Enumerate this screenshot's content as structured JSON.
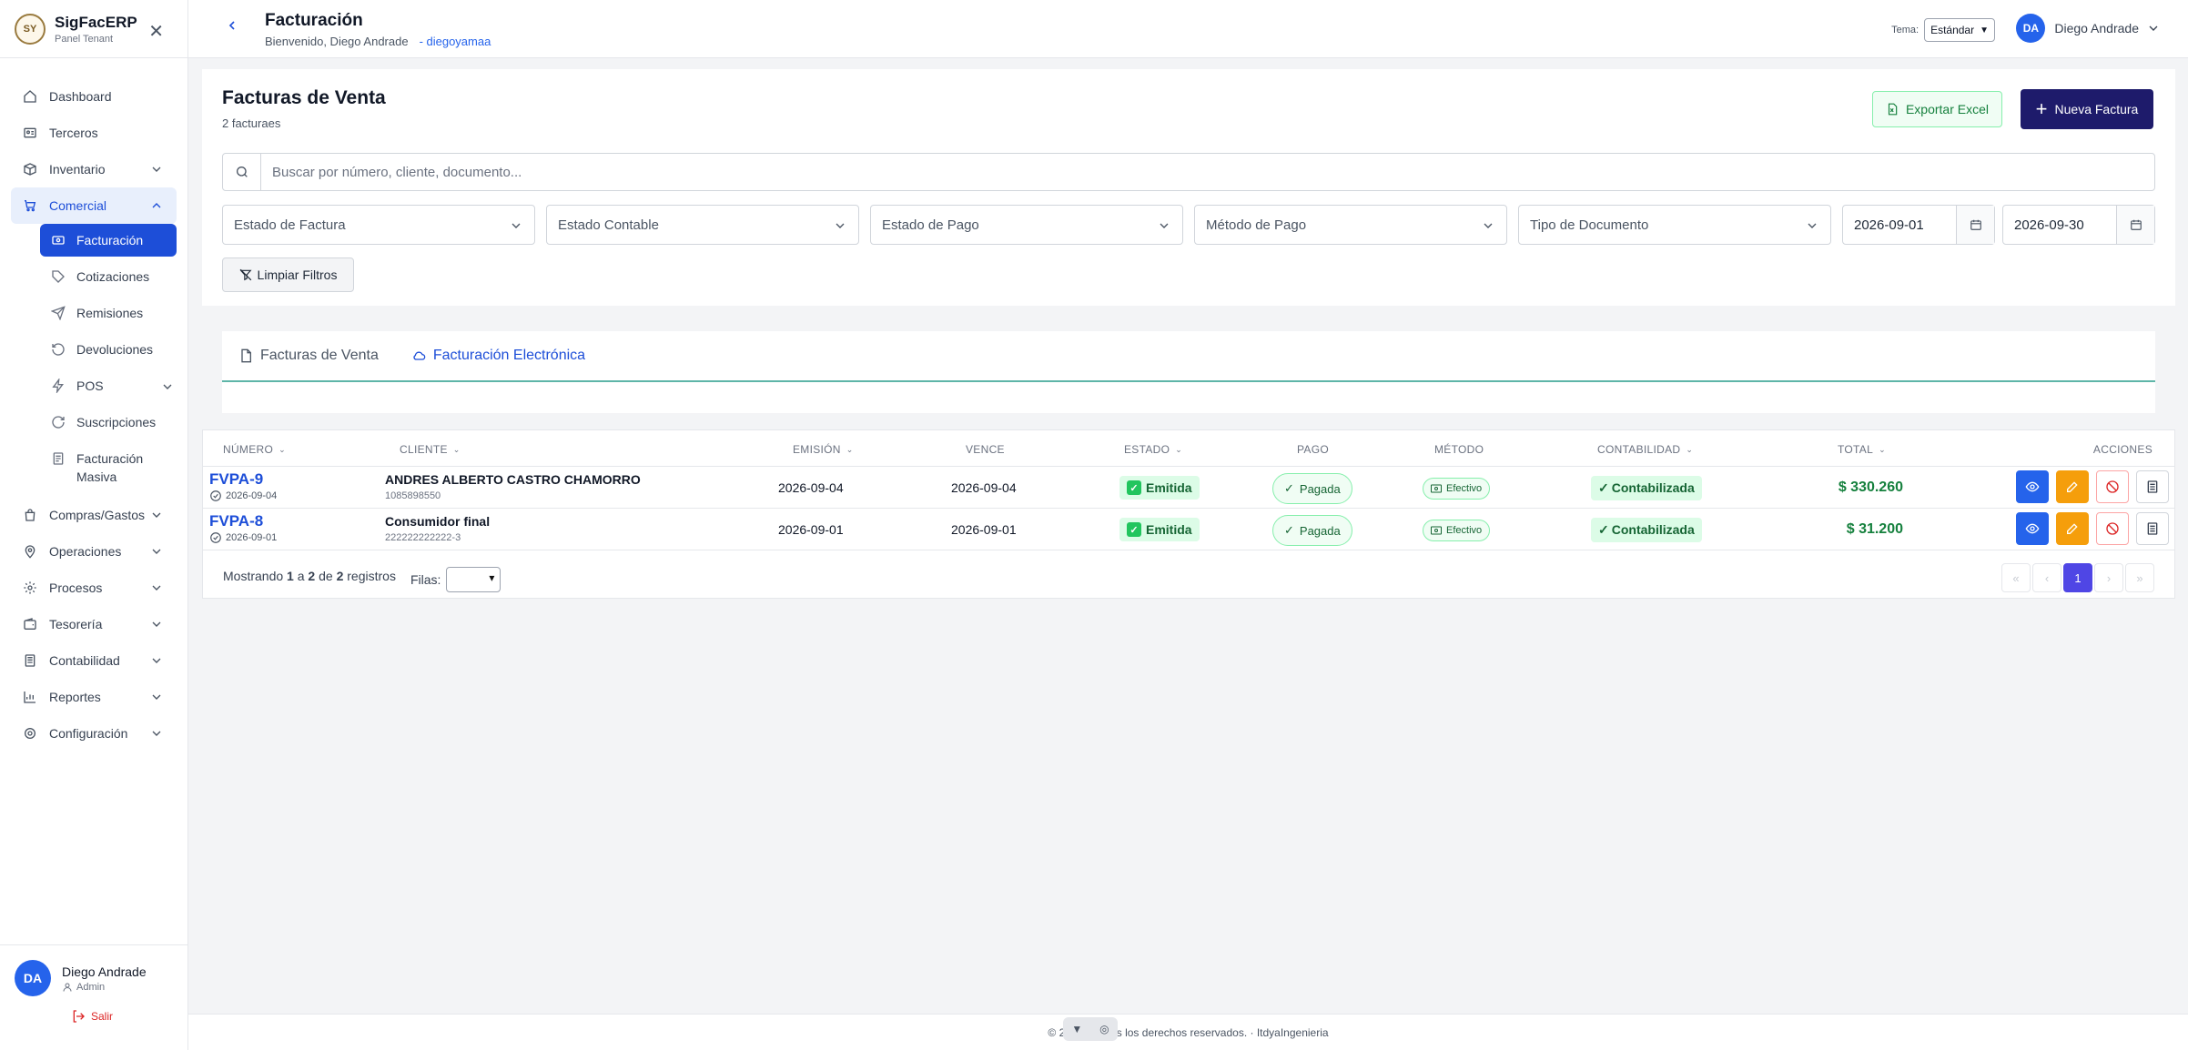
{
  "brand": {
    "logo_text": "SY",
    "title": "SigFacERP",
    "subtitle": "Panel Tenant"
  },
  "sidebar": {
    "items": [
      {
        "label": "Dashboard",
        "icon": "home-icon"
      },
      {
        "label": "Terceros",
        "icon": "id-card-icon"
      },
      {
        "label": "Inventario",
        "icon": "box-icon"
      },
      {
        "label": "Comercial",
        "icon": "cart-icon"
      }
    ],
    "comercial_sub": [
      {
        "label": "Facturación",
        "icon": "receipt-icon"
      },
      {
        "label": "Cotizaciones",
        "icon": "tag-icon"
      },
      {
        "label": "Remisiones",
        "icon": "send-icon"
      },
      {
        "label": "Devoluciones",
        "icon": "undo-icon"
      },
      {
        "label": "POS",
        "icon": "bolt-icon"
      },
      {
        "label": "Suscripciones",
        "icon": "refresh-icon"
      },
      {
        "label": "Facturación Masiva",
        "icon": "file-icon"
      }
    ],
    "bottom_items": [
      {
        "label": "Compras/Gastos",
        "icon": "bag-icon"
      },
      {
        "label": "Operaciones",
        "icon": "location-icon"
      },
      {
        "label": "Procesos",
        "icon": "gear-icon"
      },
      {
        "label": "Tesorería",
        "icon": "wallet-icon"
      },
      {
        "label": "Contabilidad",
        "icon": "ledger-icon"
      },
      {
        "label": "Reportes",
        "icon": "bar-chart-icon"
      },
      {
        "label": "Configuración",
        "icon": "settings-icon"
      }
    ],
    "user": {
      "initials": "DA",
      "name": "Diego Andrade",
      "role": "Admin",
      "logout": "Salir"
    }
  },
  "header": {
    "title": "Facturación",
    "welcome": "Bienvenido, Diego Andrade",
    "tenant": "- diegoyamaa",
    "theme_label": "Tema:",
    "theme_value": "Estándar",
    "user_initials": "DA",
    "user_name": "Diego Andrade"
  },
  "main": {
    "title": "Facturas de Venta",
    "count": "2 facturaes",
    "export_label": "Exportar Excel",
    "new_label": "Nueva Factura",
    "search_placeholder": "Buscar por número, cliente, documento...",
    "filters": [
      "Estado de Factura",
      "Estado Contable",
      "Estado de Pago",
      "Método de Pago",
      "Tipo de Documento"
    ],
    "date_from": "2026-09-01",
    "date_to": "2026-09-30",
    "clear_label": "Limpiar Filtros"
  },
  "tabs": [
    {
      "label": "Facturas de Venta",
      "active": false
    },
    {
      "label": "Facturación Electrónica",
      "active": true
    }
  ],
  "table": {
    "headers": {
      "numero": "NÚMERO",
      "cliente": "CLIENTE",
      "emision": "EMISIÓN",
      "vence": "VENCE",
      "estado": "ESTADO",
      "pago": "PAGO",
      "metodo": "MÉTODO",
      "contabilidad": "CONTABILIDAD",
      "total": "TOTAL",
      "acciones": "ACCIONES"
    },
    "rows": [
      {
        "numero": "FVPA-9",
        "fecha": "2026-09-04",
        "cliente": "ANDRES ALBERTO CASTRO CHAMORRO",
        "documento": "1085898550",
        "emision": "2026-09-04",
        "vence": "2026-09-04",
        "estado": "Emitida",
        "pago": "Pagada",
        "metodo": "Efectivo",
        "contabilidad": "Contabilizada",
        "total": "$ 330.260"
      },
      {
        "numero": "FVPA-8",
        "fecha": "2026-09-01",
        "cliente": "Consumidor final",
        "documento": "222222222222-3",
        "emision": "2026-09-01",
        "vence": "2026-09-01",
        "estado": "Emitida",
        "pago": "Pagada",
        "metodo": "Efectivo",
        "contabilidad": "Contabilizada",
        "total": "$ 31.200"
      }
    ],
    "footer": {
      "prefix": "Mostrando",
      "from": "1",
      "sep1": "a",
      "to": "2",
      "sep2": "de",
      "total": "2",
      "suffix": "registros",
      "rows_label": "Filas:",
      "page": "1"
    }
  },
  "footer": {
    "text": "© 2026 · Todos los derechos reservados. · ItdyaIngenieria"
  },
  "colors": {
    "accent": "#1d4ed8",
    "brand_dark": "#1e1b6b",
    "success": "#15803d",
    "warning": "#f59e0b",
    "danger": "#dc2626"
  }
}
